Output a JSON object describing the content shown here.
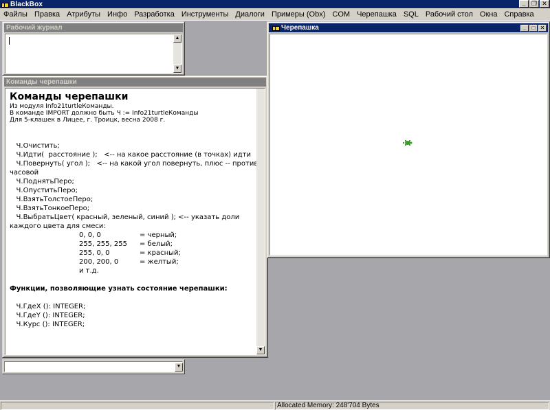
{
  "app": {
    "title": "BlackBox"
  },
  "menu": [
    "Файлы",
    "Правка",
    "Атрибуты",
    "Инфо",
    "Разработка",
    "Инструменты",
    "Диалоги",
    "Примеры (Obx)",
    "COM",
    "Черепашка",
    "SQL",
    "Рабочий стол",
    "Окна",
    "Справка"
  ],
  "journal": {
    "title": "Рабочий журнал"
  },
  "commands": {
    "title": "Команды черепашки",
    "heading": "Команды черепашки",
    "intro": [
      "Из модуля Info21turtleКоманды.",
      "В команде IMPORT должно быть Ч := Info21turtleКоманды",
      "Для 5-клашек в Лицее, г. Троицк, весна 2008 г."
    ],
    "lines": [
      "   Ч.Очистить;",
      "",
      "   Ч.Идти(  расстояние );   <-- на какое расстояние (в точках) идти",
      "   Ч.Повернуть( угол );   <-- на какой угол повернуть, плюс -- против",
      "часовой",
      "",
      "   Ч.ПоднятьПеро;",
      "   Ч.ОпуститьПеро;",
      "",
      "   Ч.ВзятьТолстоеПеро;",
      "   Ч.ВзятьТонкоеПеро;",
      "",
      "   Ч.ВыбратьЦвет( красный, зеленый, синий ); <-- указать доли",
      "каждого цвета для смеси:"
    ],
    "colors": [
      {
        "rgb": "0, 0, 0",
        "name": "= черный;"
      },
      {
        "rgb": "255, 255, 255",
        "name": "= белый;"
      },
      {
        "rgb": "255, 0, 0",
        "name": "= красный;"
      },
      {
        "rgb": "200, 200, 0",
        "name": "= желтый;"
      },
      {
        "rgb": "и т.д.",
        "name": ""
      }
    ],
    "functions_heading": "Функции, позволяющие узнать состояние черепашки:",
    "functions": [
      "   Ч.ГдеX (): INTEGER;",
      "   Ч.ГдеY (): INTEGER;",
      "   Ч.Курс (): INTEGER;"
    ]
  },
  "turtle": {
    "title": "Черепашка",
    "sprite_color": "#3a9a2a"
  },
  "status": {
    "left": "",
    "right": "Allocated Memory: 248'704 Bytes"
  },
  "colors": {
    "titlebar_active": "#0a246a",
    "titlebar_inactive": "#808080",
    "desktop": "#a7a6ab",
    "face": "#d4d0c8"
  }
}
